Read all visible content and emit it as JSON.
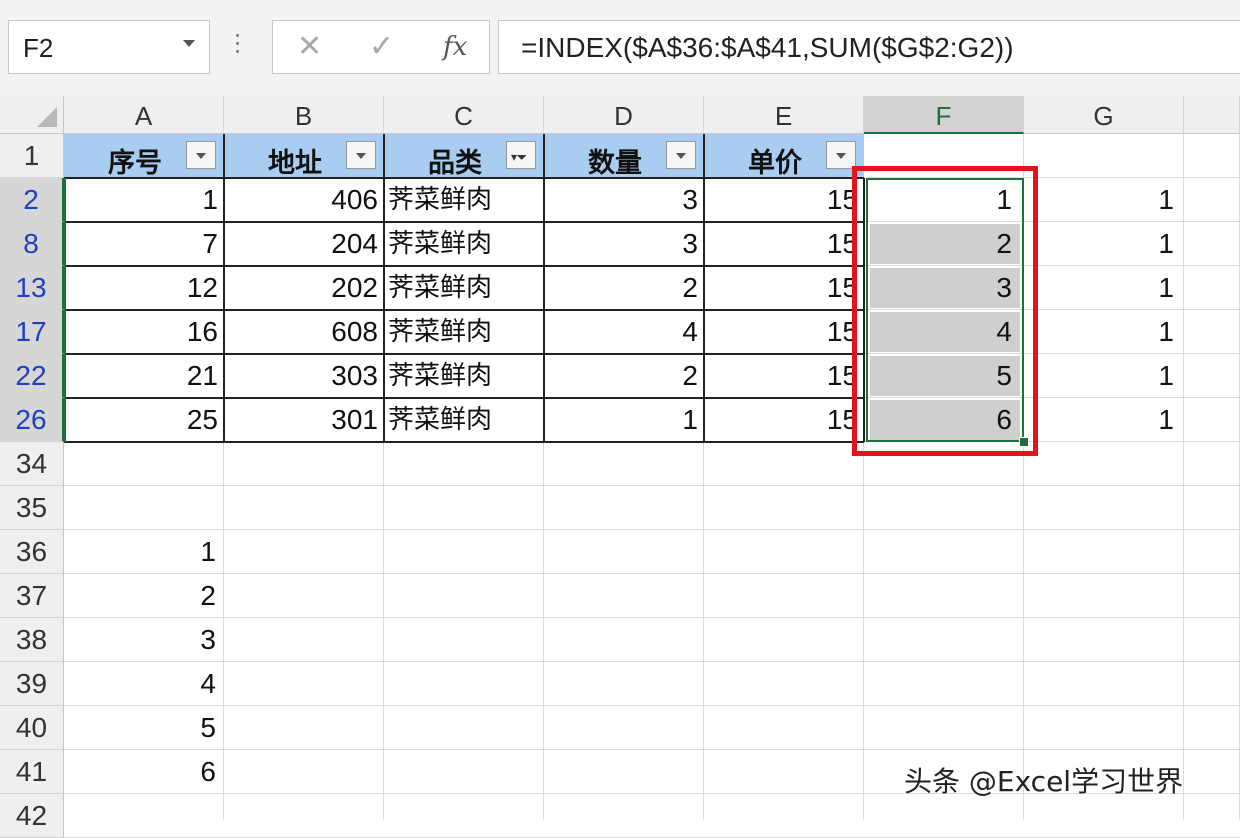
{
  "formula_bar": {
    "name_box": "F2",
    "cancel_symbol": "✕",
    "enter_symbol": "✓",
    "fx_label": "fx",
    "formula": "=INDEX($A$36:$A$41,SUM($G$2:G2))"
  },
  "columns": [
    "A",
    "B",
    "C",
    "D",
    "E",
    "F",
    "G"
  ],
  "selected_column": "F",
  "table_header": {
    "row_label": "1",
    "cells": [
      {
        "col": "A",
        "label": "序号",
        "filter": "dropdown"
      },
      {
        "col": "B",
        "label": "地址",
        "filter": "dropdown"
      },
      {
        "col": "C",
        "label": "品类",
        "filter": "filtered"
      },
      {
        "col": "D",
        "label": "数量",
        "filter": "dropdown"
      },
      {
        "col": "E",
        "label": "单价",
        "filter": "dropdown"
      }
    ]
  },
  "data_rows": [
    {
      "row": "2",
      "A": "1",
      "B": "406",
      "C": "荠菜鲜肉",
      "D": "3",
      "E": "15",
      "F": "1",
      "G": "1"
    },
    {
      "row": "8",
      "A": "7",
      "B": "204",
      "C": "荠菜鲜肉",
      "D": "3",
      "E": "15",
      "F": "2",
      "G": "1"
    },
    {
      "row": "13",
      "A": "12",
      "B": "202",
      "C": "荠菜鲜肉",
      "D": "2",
      "E": "15",
      "F": "3",
      "G": "1"
    },
    {
      "row": "17",
      "A": "16",
      "B": "608",
      "C": "荠菜鲜肉",
      "D": "4",
      "E": "15",
      "F": "4",
      "G": "1"
    },
    {
      "row": "22",
      "A": "21",
      "B": "303",
      "C": "荠菜鲜肉",
      "D": "2",
      "E": "15",
      "F": "5",
      "G": "1"
    },
    {
      "row": "26",
      "A": "25",
      "B": "301",
      "C": "荠菜鲜肉",
      "D": "1",
      "E": "15",
      "F": "6",
      "G": "1"
    }
  ],
  "lower_rows": [
    {
      "row": "34",
      "A": ""
    },
    {
      "row": "35",
      "A": ""
    },
    {
      "row": "36",
      "A": "1"
    },
    {
      "row": "37",
      "A": "2"
    },
    {
      "row": "38",
      "A": "3"
    },
    {
      "row": "39",
      "A": "4"
    },
    {
      "row": "40",
      "A": "5"
    },
    {
      "row": "41",
      "A": "6"
    },
    {
      "row": "42",
      "A": ""
    }
  ],
  "colors": {
    "header_fill": "#a9cdf0",
    "highlight_box": "#e4141c",
    "selection": "#1e6e3e",
    "filtered_row_number": "#1f3fbf"
  },
  "watermark": "头条 @Excel学习世界"
}
